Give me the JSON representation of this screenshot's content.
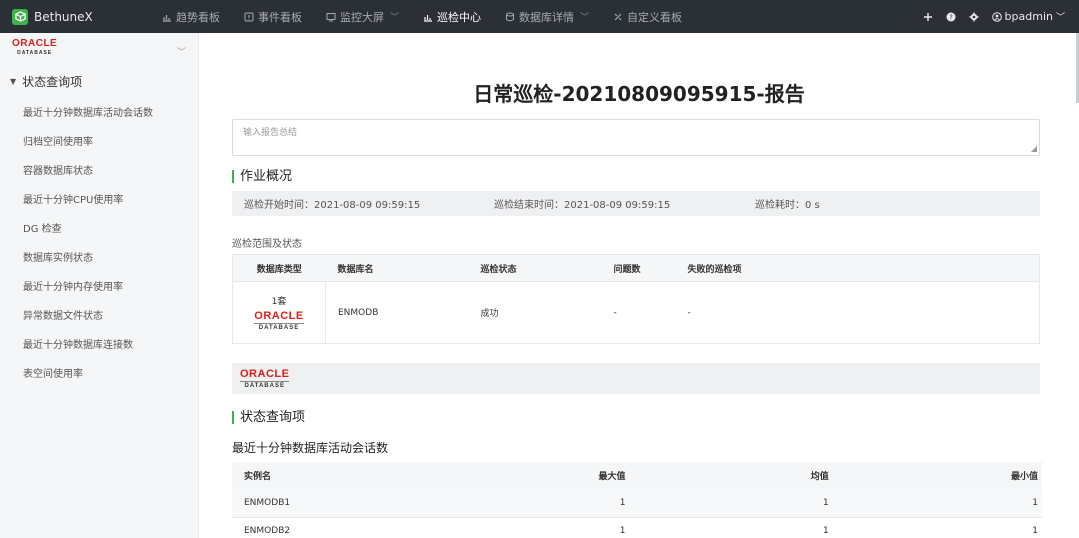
{
  "topbar": {
    "brand": "BethuneX",
    "navs": [
      {
        "label": "趋势看板",
        "icon": "chart-icon",
        "caret": false,
        "active": false
      },
      {
        "label": "事件看板",
        "icon": "alert-icon",
        "caret": false,
        "active": false
      },
      {
        "label": "监控大屏",
        "icon": "monitor-icon",
        "caret": true,
        "active": false
      },
      {
        "label": "巡检中心",
        "icon": "chart-icon",
        "caret": false,
        "active": true
      },
      {
        "label": "数据库详情",
        "icon": "database-icon",
        "caret": true,
        "active": false
      },
      {
        "label": "自定义看板",
        "icon": "custom-icon",
        "caret": false,
        "active": false
      }
    ],
    "user": "bpadmin"
  },
  "sidebar": {
    "db_logo_top": "ORACLE",
    "db_logo_bottom": "DATABASE",
    "section": "状态查询项",
    "items": [
      "最近十分钟数据库活动会话数",
      "归档空间使用率",
      "容器数据库状态",
      "最近十分钟CPU使用率",
      "DG 检查",
      "数据库实例状态",
      "最近十分钟内存使用率",
      "异常数据文件状态",
      "最近十分钟数据库连接数",
      "表空间使用率"
    ]
  },
  "report": {
    "title": "日常巡检-20210809095915-报告",
    "summary_placeholder": "输入报告总结",
    "overview_heading": "作业概况",
    "start_time": "巡检开始时间：2021-08-09 09:59:15",
    "end_time": "巡检结束时间：2021-08-09 09:59:15",
    "duration": "巡检耗时：0 s",
    "scope_label": "巡检范围及状态",
    "scope_table": {
      "headers": [
        "数据库类型",
        "数据库名",
        "巡检状态",
        "问题数",
        "失败的巡检项"
      ],
      "row": {
        "count": "1套",
        "db_name": "ENMODB",
        "status": "成功",
        "issues": "-",
        "failed": "-"
      }
    },
    "banner_logo_top": "ORACLE",
    "banner_logo_bottom": "DATABASE",
    "status_heading": "状态查询项",
    "sub_heading": "最近十分钟数据库活动会话数",
    "metric_table": {
      "headers": [
        "实例名",
        "最大值",
        "均值",
        "最小值"
      ],
      "rows": [
        {
          "name": "ENMODB1",
          "max": "1",
          "avg": "1",
          "min": "1"
        },
        {
          "name": "ENMODB2",
          "max": "1",
          "avg": "1",
          "min": "1"
        }
      ]
    }
  },
  "colors": {
    "accent": "#3fb24b",
    "topbar": "#2b2f36",
    "oracle_red": "#e0201b"
  }
}
